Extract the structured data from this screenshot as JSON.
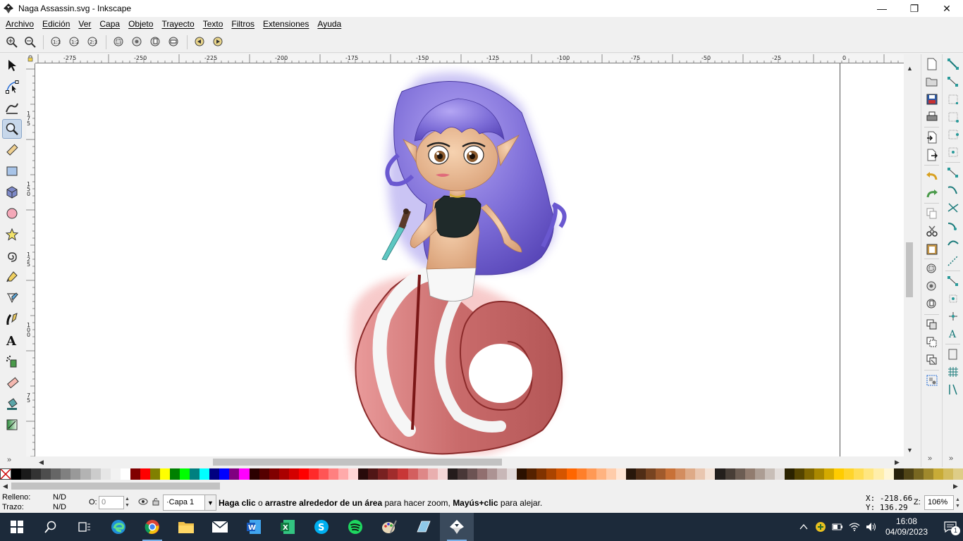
{
  "window": {
    "title": "Naga Assassin.svg - Inkscape",
    "minimize": "—",
    "maximize": "❐",
    "close": "✕"
  },
  "menu": [
    "Archivo",
    "Edición",
    "Ver",
    "Capa",
    "Objeto",
    "Trayecto",
    "Texto",
    "Filtros",
    "Extensiones",
    "Ayuda"
  ],
  "ruler": {
    "top_labels": [
      "-275",
      "-250",
      "-225",
      "-200",
      "-175",
      "-150",
      "-125",
      "-100",
      "-75",
      "-50",
      "-25",
      "0"
    ],
    "left_labels": [
      "175",
      "150",
      "125",
      "100",
      "75"
    ]
  },
  "palette": {
    "colors": [
      "#000000",
      "#1a1a1a",
      "#333333",
      "#4d4d4d",
      "#666666",
      "#808080",
      "#999999",
      "#b3b3b3",
      "#cccccc",
      "#e6e6e6",
      "#f2f2f2",
      "#ffffff",
      "#800000",
      "#ff0000",
      "#808000",
      "#ffff00",
      "#008000",
      "#00ff00",
      "#008080",
      "#00ffff",
      "#000080",
      "#0000ff",
      "#800080",
      "#ff00ff",
      "#2b0000",
      "#550000",
      "#800000",
      "#aa0000",
      "#d40000",
      "#ff0000",
      "#ff2a2a",
      "#ff5555",
      "#ff8080",
      "#ffaaaa",
      "#ffd5d5",
      "#280b0b",
      "#501616",
      "#782121",
      "#a02c2c",
      "#c83737",
      "#d35f5f",
      "#de8787",
      "#e9afaf",
      "#f4d7d7",
      "#241c1c",
      "#483737",
      "#6c5353",
      "#916f6f",
      "#ac9393",
      "#c8b7b7",
      "#e3dbdb",
      "#2b1100",
      "#552200",
      "#803300",
      "#aa4400",
      "#d45500",
      "#ff6600",
      "#ff7f2a",
      "#ff9955",
      "#ffb380",
      "#ffccaa",
      "#ffe6d5",
      "#28170b",
      "#502d16",
      "#784421",
      "#a05a2c",
      "#c87137",
      "#d38d5f",
      "#deaa87",
      "#e9c6af",
      "#f4e3d7",
      "#241f1c",
      "#483e37",
      "#6c5d53",
      "#917c6f",
      "#ac9d93",
      "#c8beb7",
      "#e3dedb",
      "#2b2200",
      "#554400",
      "#806600",
      "#aa8800",
      "#d4aa00",
      "#ffcc00",
      "#ffd42a",
      "#ffdd55",
      "#ffe680",
      "#ffeeaa",
      "#fff6d5",
      "#28220b",
      "#504416",
      "#786721",
      "#a0892c",
      "#c8ab37",
      "#d3bc5f",
      "#decd87"
    ]
  },
  "status": {
    "fill_label": "Relleno:",
    "fill_value": "N/D",
    "stroke_label": "Trazo:",
    "stroke_value": "N/D",
    "opacity_label": "O:",
    "opacity_value": "0",
    "layer": "·Capa 1",
    "message_parts": [
      "Haga clic",
      " o ",
      "arrastre alrededor de un área",
      " para hacer zoom, ",
      "Mayús+clic",
      " para alejar."
    ],
    "x_label": "X:",
    "x_value": "-218.66",
    "y_label": "Y:",
    "y_value": "136.29",
    "zoom_label": "Z:",
    "zoom_value": "106%"
  },
  "taskbar": {
    "time": "16:08",
    "date": "04/09/2023",
    "notifications": "1"
  },
  "colors": {
    "hair": "#7b6bd6",
    "skin": "#e8b48a",
    "tail": "#c96b6b",
    "tail_belly": "#f4f4f4",
    "taskbar": "#1c2a3a"
  }
}
